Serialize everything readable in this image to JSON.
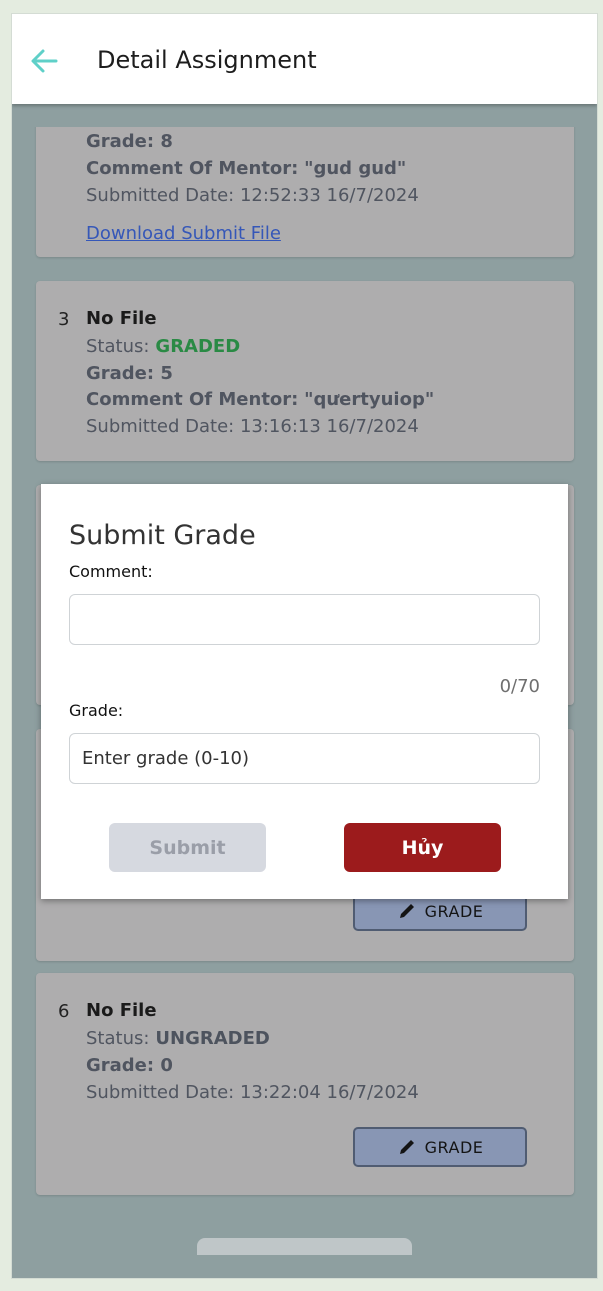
{
  "appbar": {
    "title": "Detail Assignment",
    "back_icon": "arrow-left-icon"
  },
  "labels": {
    "status": "Status:",
    "grade": "Grade:",
    "comment_of_mentor": "Comment Of Mentor:",
    "submitted_date": "Submitted Date:",
    "download": "Download Submit File",
    "grade_button": "GRADE"
  },
  "submissions": [
    {
      "grade": "8",
      "comment": "\"gud gud\"",
      "submitted_date": "12:52:33 16/7/2024"
    },
    {
      "index": "3",
      "file": "No File",
      "status": "GRADED",
      "grade": "5",
      "comment": "\"qưertyuiop\"",
      "submitted_date": "13:16:13 16/7/2024"
    },
    {
      "index": "6",
      "file": "No File",
      "status": "UNGRADED",
      "grade": "0",
      "submitted_date": "13:22:04 16/7/2024"
    }
  ],
  "modal": {
    "title": "Submit Grade",
    "comment_label": "Comment:",
    "comment_value": "",
    "counter": "0/70",
    "grade_label": "Grade:",
    "grade_placeholder": "Enter grade (0-10)",
    "submit_label": "Submit",
    "cancel_label": "Hủy"
  },
  "colors": {
    "graded": "#2a8a45",
    "cancel": "#9c1b1c",
    "back_arrow": "#5fd0c8"
  }
}
